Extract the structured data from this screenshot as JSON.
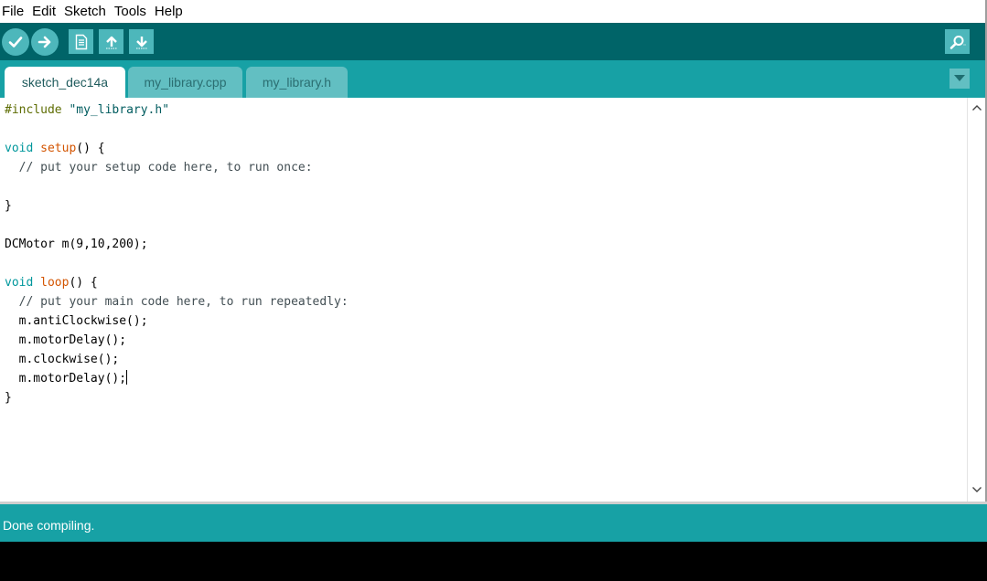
{
  "menu": {
    "items": [
      "File",
      "Edit",
      "Sketch",
      "Tools",
      "Help"
    ]
  },
  "toolbar": {
    "buttons": [
      {
        "name": "verify",
        "icon": "check-icon"
      },
      {
        "name": "upload",
        "icon": "arrow-right-icon"
      },
      {
        "name": "new",
        "icon": "new-file-icon"
      },
      {
        "name": "open",
        "icon": "arrow-up-icon"
      },
      {
        "name": "save",
        "icon": "arrow-down-icon"
      },
      {
        "name": "serial-monitor",
        "icon": "magnifier-icon"
      }
    ]
  },
  "tabs": [
    {
      "label": "sketch_dec14a",
      "active": true
    },
    {
      "label": "my_library.cpp",
      "active": false
    },
    {
      "label": "my_library.h",
      "active": false
    }
  ],
  "editor": {
    "code": [
      {
        "text": "#include \"my_library.h\""
      },
      {
        "text": ""
      },
      {
        "text": "void setup() {"
      },
      {
        "text": "  // put your setup code here, to run once:"
      },
      {
        "text": ""
      },
      {
        "text": "}"
      },
      {
        "text": ""
      },
      {
        "text": "DCMotor m(9,10,200);"
      },
      {
        "text": ""
      },
      {
        "text": "void loop() {"
      },
      {
        "text": "  // put your main code here, to run repeatedly:"
      },
      {
        "text": "  m.antiClockwise();"
      },
      {
        "text": "  m.motorDelay();"
      },
      {
        "text": "  m.clockwise();"
      },
      {
        "text": "  m.motorDelay();"
      },
      {
        "text": "}"
      }
    ]
  },
  "status": {
    "message": "Done compiling."
  },
  "colors": {
    "toolbar": "#006468",
    "tabbar": "#17a1a5",
    "button": "#4db7bb",
    "keyword_type": "#00979c",
    "keyword_fn": "#d35400",
    "preprocessor": "#5e6d03"
  }
}
